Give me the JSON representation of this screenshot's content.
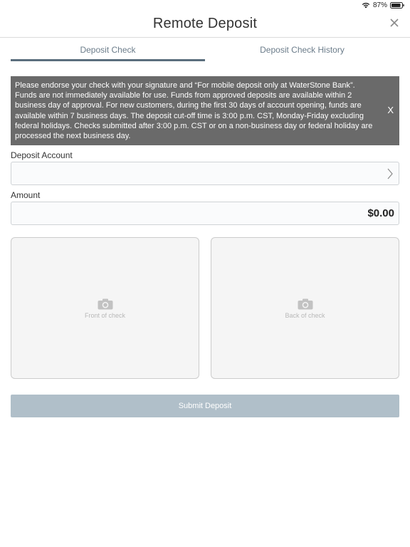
{
  "status": {
    "battery_percent": "87%"
  },
  "header": {
    "title": "Remote Deposit"
  },
  "tabs": [
    {
      "label": "Deposit Check",
      "active": true
    },
    {
      "label": "Deposit Check History",
      "active": false
    }
  ],
  "notice": {
    "text": "Please endorse your check with your signature and “For mobile deposit only at WaterStone Bank”. Funds are not immediately available for use. Funds from approved deposits are available within 2 business day of approval. For new customers, during the first 30 days of account opening, funds are available within 7 business days. The deposit cut-off time is 3:00 p.m. CST, Monday-Friday excluding federal holidays. Checks submitted after 3:00 p.m. CST or on a non-business day or federal holiday are processed the next business day.",
    "close_label": "X"
  },
  "form": {
    "account_label": "Deposit Account",
    "account_value": "",
    "amount_label": "Amount",
    "amount_value": "$0.00"
  },
  "check_images": {
    "front_label": "Front of check",
    "back_label": "Back of check"
  },
  "submit_label": "Submit Deposit",
  "colors": {
    "notice_bg": "#6a6a6a",
    "tab_indicator": "#5b6e7d",
    "submit_disabled": "#b0bfc9"
  }
}
